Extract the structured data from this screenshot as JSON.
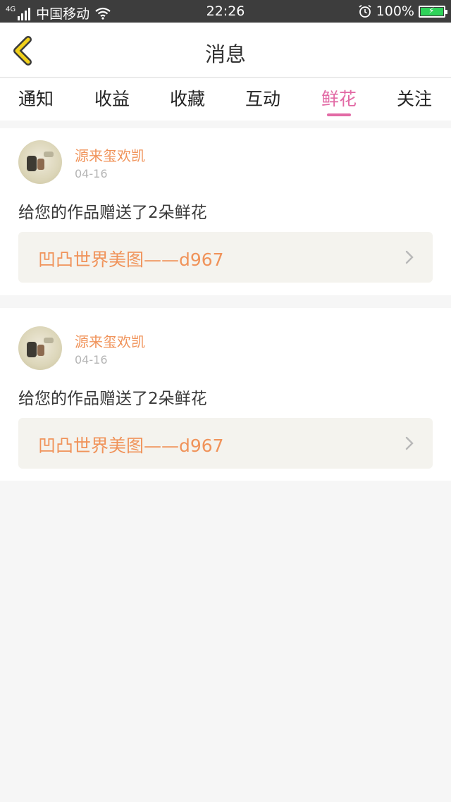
{
  "status_bar": {
    "network": "4G",
    "carrier": "中国移动",
    "time": "22:26",
    "battery": "100%"
  },
  "header": {
    "title": "消息"
  },
  "tabs": [
    {
      "label": "通知",
      "active": false
    },
    {
      "label": "收益",
      "active": false
    },
    {
      "label": "收藏",
      "active": false
    },
    {
      "label": "互动",
      "active": false
    },
    {
      "label": "鲜花",
      "active": true
    },
    {
      "label": "关注",
      "active": false
    }
  ],
  "messages": [
    {
      "username": "源来玺欢凯",
      "date": "04-16",
      "text": "给您的作品赠送了2朵鲜花",
      "work_title": "凹凸世界美图——d967"
    },
    {
      "username": "源来玺欢凯",
      "date": "04-16",
      "text": "给您的作品赠送了2朵鲜花",
      "work_title": "凹凸世界美图——d967"
    }
  ],
  "colors": {
    "accent_tab": "#e26aa5",
    "username": "#f0935a",
    "back_arrow": "#f2d11a"
  }
}
